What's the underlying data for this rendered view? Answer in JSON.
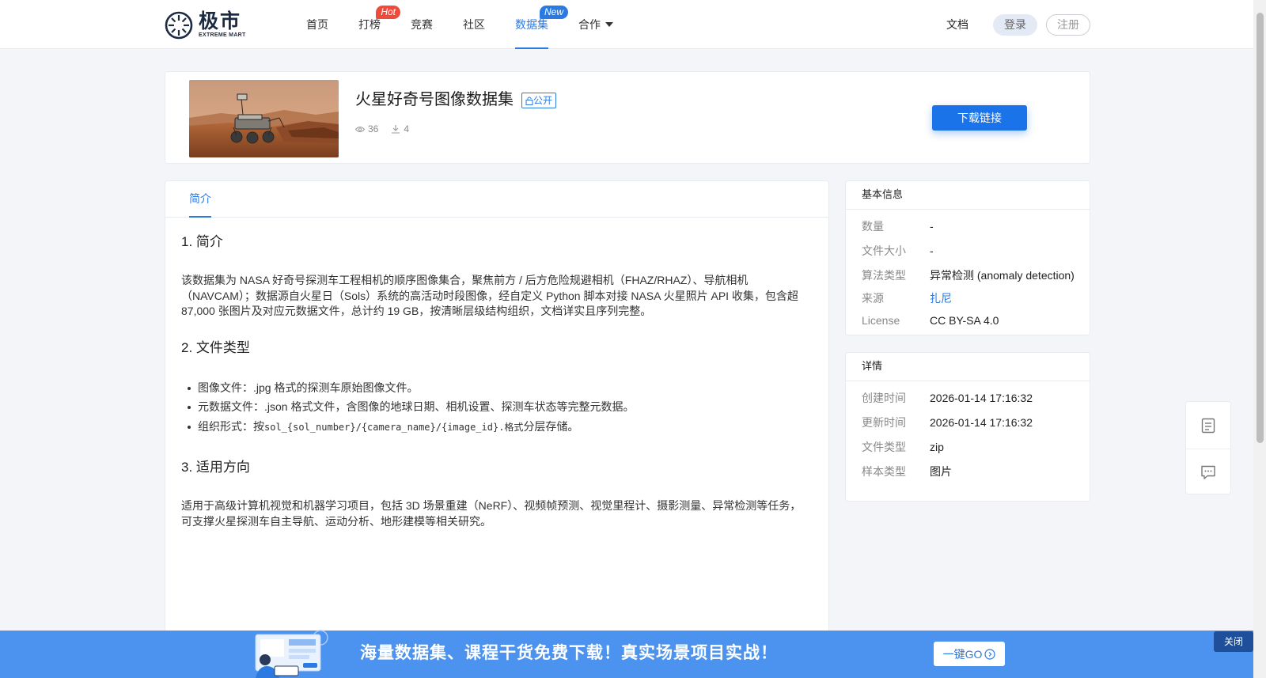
{
  "header": {
    "logo_cn": "极市",
    "logo_en": "EXTREME MART",
    "nav": [
      {
        "label": "首页"
      },
      {
        "label": "打榜",
        "badge": "Hot"
      },
      {
        "label": "竞赛"
      },
      {
        "label": "社区"
      },
      {
        "label": "数据集",
        "badge": "New",
        "active": true
      },
      {
        "label": "合作"
      }
    ],
    "docs": "文档",
    "login": "登录",
    "register": "注册"
  },
  "dataset": {
    "title": "火星好奇号图像数据集",
    "visibility": "公开",
    "views": "36",
    "downloads": "4",
    "download_button": "下载链接"
  },
  "tabs": {
    "intro": "简介"
  },
  "article": {
    "s1_title": "1. 简介",
    "s1_p1": "该数据集为 NASA 好奇号探测车工程相机的顺序图像集合，聚焦前方 / 后方危险规避相机（FHAZ/RHAZ）、导航相机",
    "s1_p2": "（NAVCAM）；数据源自火星日（Sols）系统的高活动时段图像，经自定义 Python 脚本对接 NASA 火星照片 API 收集，包含超",
    "s1_p3": "87,000 张图片及对应元数据文件，总计约 19 GB，按清晰层级结构组织，文档详实且序列完整。",
    "s2_title": "2. 文件类型",
    "s2_item1": "图像文件：.jpg 格式的探测车原始图像文件。",
    "s2_item2": "元数据文件：.json 格式文件，含图像的地球日期、相机设置、探测车状态等完整元数据。",
    "s2_item3_prefix": "组织形式：按",
    "s2_item3_code": "sol_{sol_number}/{camera_name}/{image_id}.格式",
    "s2_item3_suffix": "分层存储。",
    "s3_title": "3. 适用方向",
    "s3_p1": "适用于高级计算机视觉和机器学习项目，包括 3D 场景重建（NeRF）、视频帧预测、视觉里程计、摄影测量、异常检测等任务，",
    "s3_p2": "可支撑火星探测车自主导航、运动分析、地形建模等相关研究。"
  },
  "basic_info": {
    "title": "基本信息",
    "rows": [
      {
        "key": "数量",
        "value": "-"
      },
      {
        "key": "文件大小",
        "value": "-"
      },
      {
        "key": "算法类型",
        "value": "异常检测 (anomaly detection)"
      },
      {
        "key": "来源",
        "value": "扎尼"
      },
      {
        "key": "License",
        "value": "CC BY-SA 4.0"
      }
    ]
  },
  "details": {
    "title": "详情",
    "rows": [
      {
        "key": "创建时间",
        "value": "2026-01-14 17:16:32"
      },
      {
        "key": "更新时间",
        "value": "2026-01-14 17:16:32"
      },
      {
        "key": "文件类型",
        "value": "zip"
      },
      {
        "key": "样本类型",
        "value": "图片"
      }
    ]
  },
  "promo": {
    "text": "海量数据集、课程干货免费下载！真实场景项目实战！",
    "button": "一键GO",
    "close": "关闭"
  },
  "colors": {
    "accent": "#2a7ae2",
    "hot": "#f04a3a",
    "promo_bg": "#4b93ef"
  },
  "icons": [
    "eye-icon",
    "download-icon",
    "public-icon",
    "document-icon",
    "chat-icon",
    "arrow-circle-icon",
    "caret-down-icon"
  ]
}
